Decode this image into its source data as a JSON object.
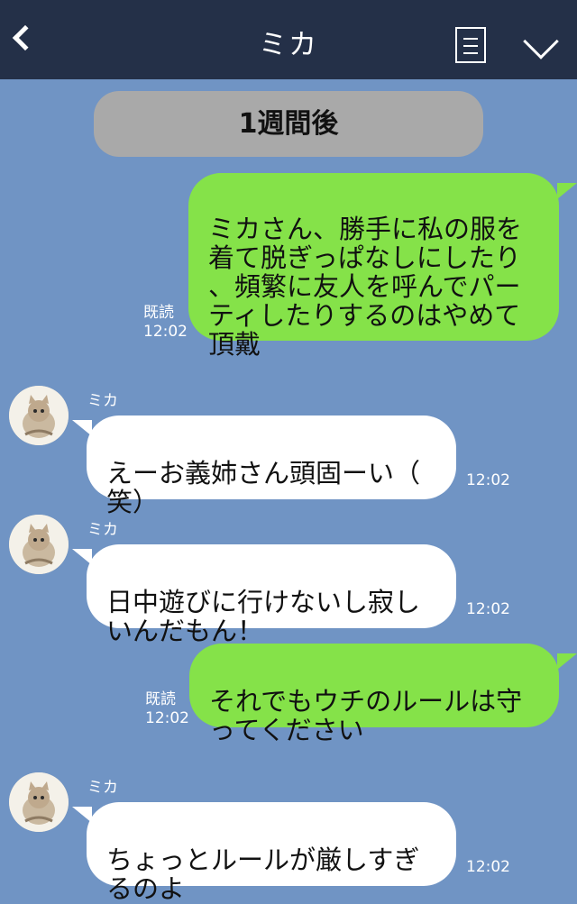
{
  "header": {
    "title": "ミカ",
    "icons": {
      "back": "chevron-left-icon",
      "menu": "list-icon",
      "collapse": "chevron-down-icon"
    }
  },
  "date_separator": "1週間後",
  "messages": [
    {
      "direction": "out",
      "text": "ミカさん、勝手に私の服を\n着て脱ぎっぱなしにしたり\n、頻繁に友人を呼んでパー\nティしたりするのはやめて\n頂戴",
      "read_label": "既読",
      "time": "12:02"
    },
    {
      "direction": "in",
      "sender": "ミカ",
      "text": "えーお義姉さん頭固ーい（\n笑）",
      "time": "12:02"
    },
    {
      "direction": "in",
      "sender": "ミカ",
      "text": "日中遊びに行けないし寂し\nいんだもん！",
      "time": "12:02"
    },
    {
      "direction": "out",
      "text": "それでもウチのルールは守\nってください",
      "read_label": "既読",
      "time": "12:02"
    },
    {
      "direction": "in",
      "sender": "ミカ",
      "text": "ちょっとルールが厳しすぎ\nるのよ",
      "time": "12:02"
    }
  ],
  "colors": {
    "background": "#7094c4",
    "header": "#243048",
    "outgoing_bubble": "#85e249",
    "incoming_bubble": "#ffffff",
    "date_pill": "#a9a9a9"
  }
}
